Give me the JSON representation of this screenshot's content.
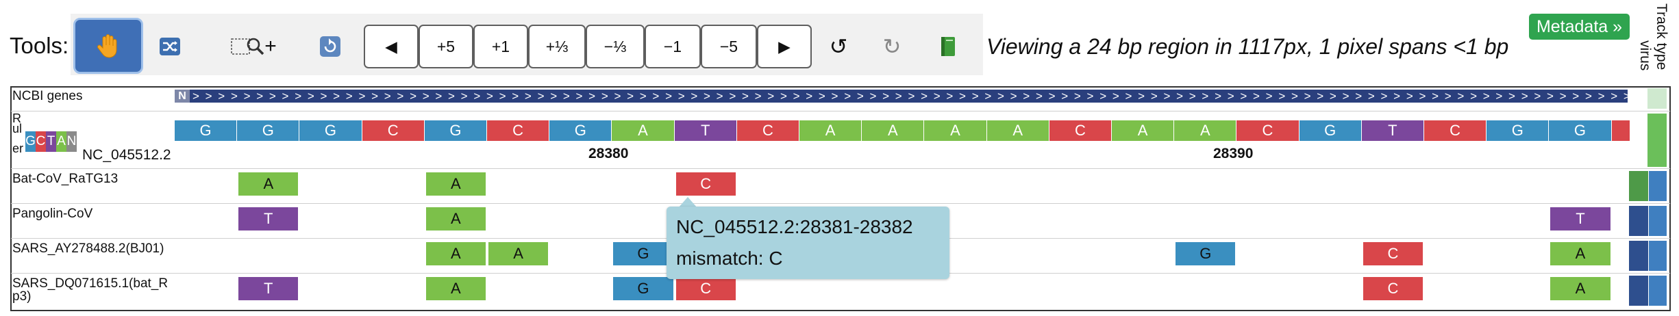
{
  "toolbar": {
    "label": "Tools:",
    "buttons": {
      "pan": "hand-icon",
      "shuffle": "shuffle-icon",
      "zoom_select_plus": "+",
      "scroll_left": "◀",
      "plus5": "+5",
      "plus1": "+1",
      "plus_third": "+⅓",
      "minus_third": "−⅓",
      "minus1": "−1",
      "minus5": "−5",
      "scroll_right": "▶",
      "undo": "↺",
      "redo": "↻"
    },
    "view_text": "Viewing a 24 bp region in 1117px, 1 pixel spans <1 bp"
  },
  "metadata_button": "Metadata »",
  "track_type_header": [
    "Track type",
    "virus"
  ],
  "tracks": {
    "ncbi_genes": {
      "label": "NCBI genes",
      "gene_symbol": "N",
      "strand_glyphs": "> > > > > > > > > > > > > > > > > > > > > > > > > > > > > > > > > > > > > > > > > > > > > > > > > > > > > > > > > > > > > > > > > > > > > > > > > > > > > > > > > > > > > > > > > > > > > > > > > > > > > > > > > > > > > > > > >"
    },
    "ruler": {
      "label_lines": [
        "R",
        "ul",
        "er"
      ],
      "legend": [
        "G",
        "C",
        "T",
        "A",
        "N"
      ],
      "reference_name": "NC_045512.2",
      "sequence": [
        "G",
        "G",
        "G",
        "C",
        "G",
        "C",
        "G",
        "A",
        "T",
        "C",
        "A",
        "A",
        "A",
        "A",
        "C",
        "A",
        "A",
        "C",
        "G",
        "T",
        "C",
        "G",
        "G"
      ],
      "coordinates": [
        "28380",
        "28390"
      ]
    },
    "samples": [
      {
        "name": "Bat-CoV_RaTG13",
        "cells": [
          {
            "pos": 1,
            "base": "A"
          },
          {
            "pos": 4,
            "base": "A"
          },
          {
            "pos": 8,
            "base": "C"
          }
        ]
      },
      {
        "name": "Pangolin-CoV",
        "cells": [
          {
            "pos": 1,
            "base": "T"
          },
          {
            "pos": 4,
            "base": "A"
          },
          {
            "pos": 22,
            "base": "T"
          }
        ]
      },
      {
        "name": "SARS_AY278488.2(BJ01)",
        "cells": [
          {
            "pos": 4,
            "base": "A"
          },
          {
            "pos": 5,
            "base": "A"
          },
          {
            "pos": 7,
            "base": "G"
          },
          {
            "pos": 16,
            "base": "G"
          },
          {
            "pos": 19,
            "base": "C"
          },
          {
            "pos": 22,
            "base": "A"
          }
        ]
      },
      {
        "name": "SARS_DQ071615.1(bat_Rp3)",
        "name_lines": [
          "SARS_DQ071615.1(bat_R",
          "p3)"
        ],
        "cells": [
          {
            "pos": 1,
            "base": "T"
          },
          {
            "pos": 4,
            "base": "A"
          },
          {
            "pos": 7,
            "base": "G"
          },
          {
            "pos": 8,
            "base": "C"
          },
          {
            "pos": 19,
            "base": "C"
          },
          {
            "pos": 22,
            "base": "A"
          }
        ]
      }
    ]
  },
  "tooltip": {
    "region": "NC_045512.2:28381-28382",
    "detail": "mismatch: C"
  },
  "colors": {
    "A": "#7cc04a",
    "C": "#d9464a",
    "G": "#3a8fc0",
    "T": "#7b479c",
    "N": "#8a8a8a",
    "accent_blue": "#3f6fb6",
    "metadata_green": "#2fa44f",
    "tooltip_bg": "#a9d3de"
  }
}
